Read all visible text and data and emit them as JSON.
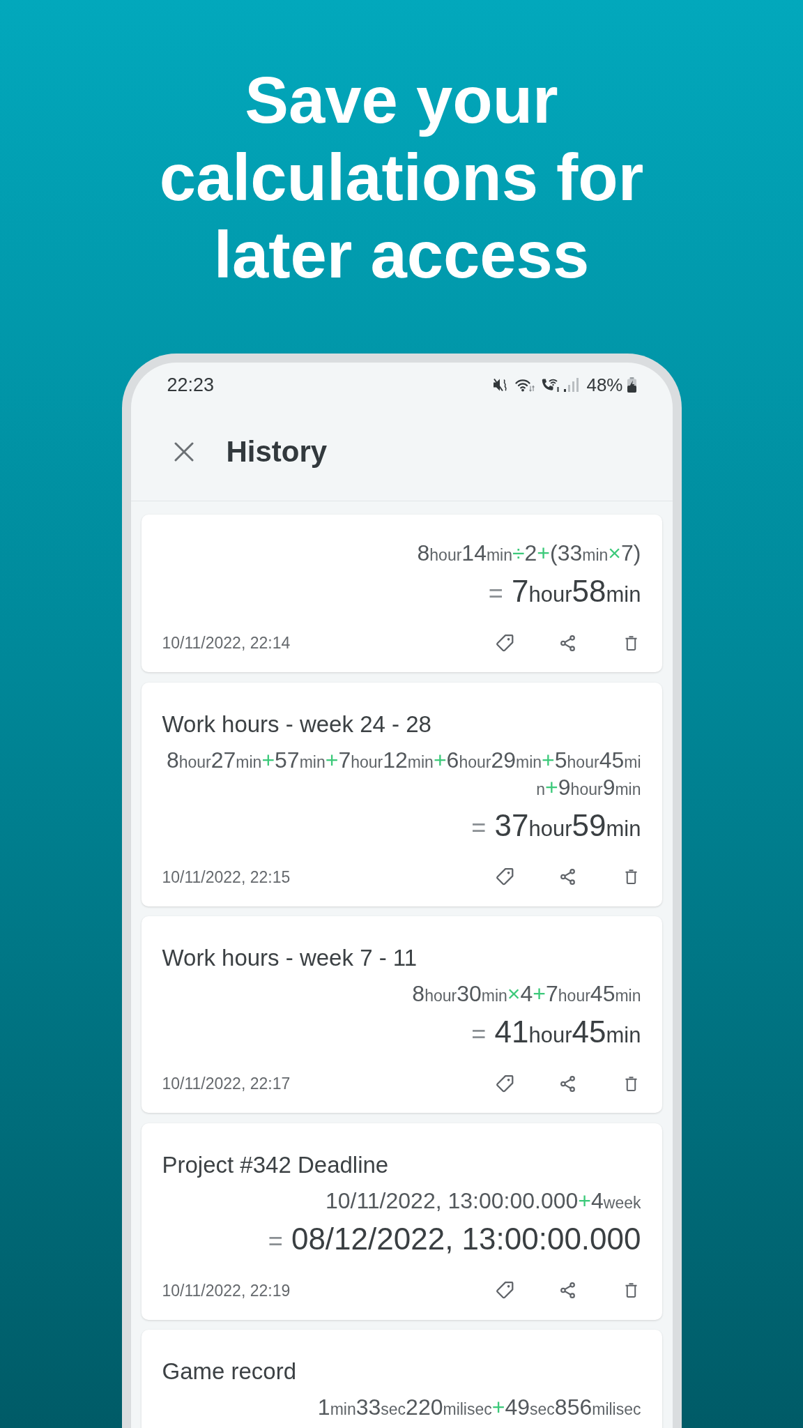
{
  "headline": "Save your calculations for later access",
  "status_bar": {
    "time": "22:23",
    "battery": "48%"
  },
  "app_bar": {
    "title": "History"
  },
  "history": [
    {
      "expression": [
        [
          {
            "kind": "value",
            "text": "8"
          },
          {
            "kind": "unit",
            "text": "hour"
          },
          {
            "kind": "value",
            "text": "14"
          },
          {
            "kind": "unit",
            "text": "min"
          },
          {
            "kind": "operator",
            "text": "÷"
          },
          {
            "kind": "value",
            "text": "2"
          },
          {
            "kind": "operator",
            "text": "+"
          },
          {
            "kind": "value",
            "text": "(33"
          },
          {
            "kind": "unit",
            "text": "min"
          },
          {
            "kind": "operator",
            "text": "×"
          },
          {
            "kind": "value",
            "text": "7)"
          }
        ]
      ],
      "result": [
        {
          "kind": "equals",
          "text": "="
        },
        {
          "kind": "value",
          "text": "7"
        },
        {
          "kind": "unit",
          "text": "hour"
        },
        {
          "kind": "value",
          "text": "58"
        },
        {
          "kind": "unit",
          "text": "min"
        }
      ],
      "timestamp": "10/11/2022, 22:14"
    },
    {
      "title": "Work hours - week 24 - 28",
      "expression": [
        [
          {
            "kind": "value",
            "text": "8"
          },
          {
            "kind": "unit",
            "text": "hour"
          },
          {
            "kind": "value",
            "text": "27"
          },
          {
            "kind": "unit",
            "text": "min"
          },
          {
            "kind": "operator",
            "text": "+"
          },
          {
            "kind": "value",
            "text": "57"
          },
          {
            "kind": "unit",
            "text": "min"
          },
          {
            "kind": "operator",
            "text": "+"
          },
          {
            "kind": "value",
            "text": "7"
          },
          {
            "kind": "unit",
            "text": "hour"
          },
          {
            "kind": "value",
            "text": "12"
          },
          {
            "kind": "unit",
            "text": "min"
          },
          {
            "kind": "operator",
            "text": "+"
          },
          {
            "kind": "value",
            "text": "6"
          },
          {
            "kind": "unit",
            "text": "hour"
          },
          {
            "kind": "value",
            "text": "29"
          },
          {
            "kind": "unit",
            "text": "min"
          },
          {
            "kind": "operator",
            "text": "+"
          },
          {
            "kind": "value",
            "text": "5"
          },
          {
            "kind": "unit",
            "text": "hour"
          },
          {
            "kind": "value",
            "text": "45"
          },
          {
            "kind": "unit",
            "text": "mi"
          }
        ],
        [
          {
            "kind": "unit",
            "text": "n"
          },
          {
            "kind": "operator",
            "text": "+"
          },
          {
            "kind": "value",
            "text": "9"
          },
          {
            "kind": "unit",
            "text": "hour"
          },
          {
            "kind": "value",
            "text": "9"
          },
          {
            "kind": "unit",
            "text": "min"
          }
        ]
      ],
      "result": [
        {
          "kind": "equals",
          "text": "="
        },
        {
          "kind": "value",
          "text": "37"
        },
        {
          "kind": "unit",
          "text": "hour"
        },
        {
          "kind": "value",
          "text": "59"
        },
        {
          "kind": "unit",
          "text": "min"
        }
      ],
      "timestamp": "10/11/2022, 22:15"
    },
    {
      "title": "Work hours - week 7 - 11",
      "expression": [
        [
          {
            "kind": "value",
            "text": "8"
          },
          {
            "kind": "unit",
            "text": "hour"
          },
          {
            "kind": "value",
            "text": "30"
          },
          {
            "kind": "unit",
            "text": "min"
          },
          {
            "kind": "operator",
            "text": "×"
          },
          {
            "kind": "value",
            "text": "4"
          },
          {
            "kind": "operator",
            "text": "+"
          },
          {
            "kind": "value",
            "text": "7"
          },
          {
            "kind": "unit",
            "text": "hour"
          },
          {
            "kind": "value",
            "text": "45"
          },
          {
            "kind": "unit",
            "text": "min"
          }
        ]
      ],
      "result": [
        {
          "kind": "equals",
          "text": "="
        },
        {
          "kind": "value",
          "text": "41"
        },
        {
          "kind": "unit",
          "text": "hour"
        },
        {
          "kind": "value",
          "text": "45"
        },
        {
          "kind": "unit",
          "text": "min"
        }
      ],
      "timestamp": "10/11/2022, 22:17"
    },
    {
      "title": "Project #342 Deadline",
      "expression": [
        [
          {
            "kind": "value",
            "text": "10/11/2022, 13:00:00.000"
          },
          {
            "kind": "operator",
            "text": "+"
          },
          {
            "kind": "value",
            "text": "4"
          },
          {
            "kind": "unit",
            "text": "week"
          }
        ]
      ],
      "result": [
        {
          "kind": "equals",
          "text": "="
        },
        {
          "kind": "value",
          "text": "08/12/2022, 13:00:00.000"
        }
      ],
      "timestamp": "10/11/2022, 22:19"
    },
    {
      "title": "Game record",
      "expression": [
        [
          {
            "kind": "value",
            "text": "1"
          },
          {
            "kind": "unit",
            "text": "min"
          },
          {
            "kind": "value",
            "text": "33"
          },
          {
            "kind": "unit",
            "text": "sec"
          },
          {
            "kind": "value",
            "text": "220"
          },
          {
            "kind": "unit",
            "text": "milisec"
          },
          {
            "kind": "operator",
            "text": "+"
          },
          {
            "kind": "value",
            "text": "49"
          },
          {
            "kind": "unit",
            "text": "sec"
          },
          {
            "kind": "value",
            "text": "856"
          },
          {
            "kind": "unit",
            "text": "milisec"
          }
        ]
      ]
    }
  ]
}
